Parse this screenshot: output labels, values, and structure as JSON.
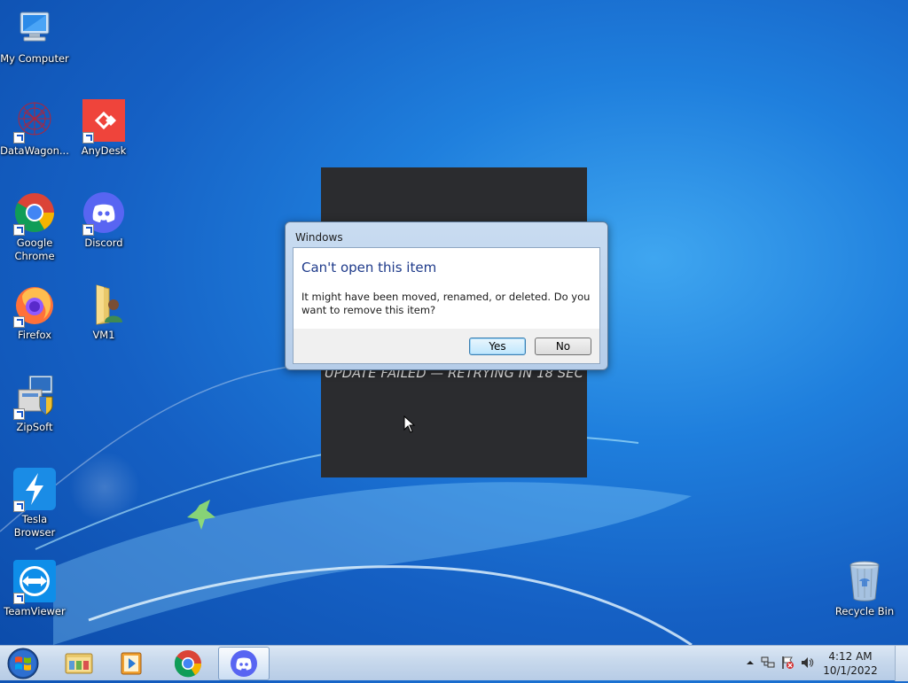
{
  "desktop": {
    "icons": [
      {
        "label": "My Computer"
      },
      {
        "label": "DataWagon..."
      },
      {
        "label": "AnyDesk"
      },
      {
        "label": "Google Chrome"
      },
      {
        "label": "Discord"
      },
      {
        "label": "Firefox"
      },
      {
        "label": "VM1"
      },
      {
        "label": "ZipSoft"
      },
      {
        "label": "Tesla Browser"
      },
      {
        "label": "TeamViewer"
      },
      {
        "label": "Recycle Bin"
      }
    ]
  },
  "splash": {
    "status_text": "UPDATE FAILED — RETRYING IN 18 SEC"
  },
  "dialog": {
    "title": "Windows",
    "heading": "Can't open this item",
    "message": "It might have been moved, renamed, or deleted. Do you want to remove this item?",
    "yes_label": "Yes",
    "no_label": "No"
  },
  "taskbar": {
    "apps": [
      "start-icon",
      "file-explorer-icon",
      "media-player-icon",
      "chrome-icon",
      "discord-icon"
    ],
    "clock_time": "4:12 AM",
    "clock_date": "10/1/2022"
  },
  "colors": {
    "dialog_heading": "#1e3a8a",
    "splash_bg": "#2b2c2f",
    "wallpaper": "#1f7fdd"
  }
}
